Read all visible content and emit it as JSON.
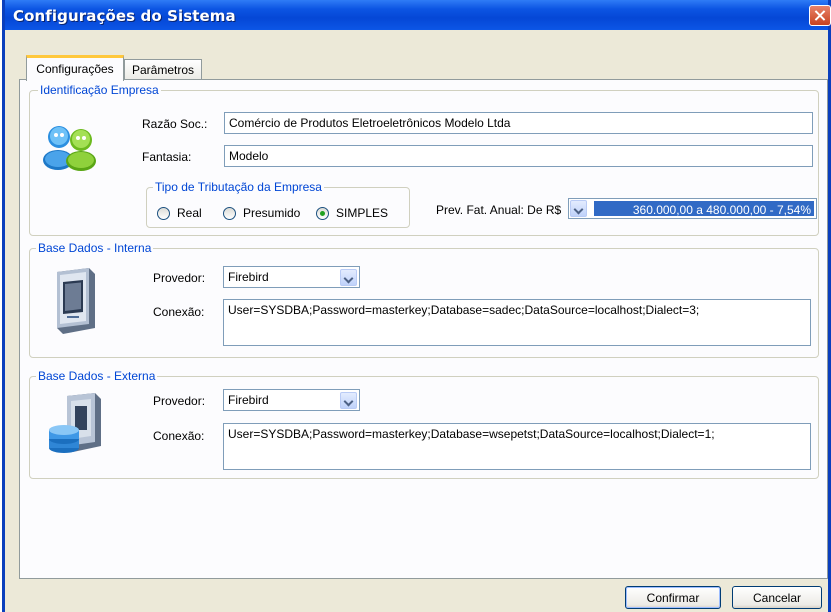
{
  "window": {
    "title": "Configurações do Sistema"
  },
  "tabs": [
    {
      "label": "Configurações",
      "active": true
    },
    {
      "label": "Parâmetros",
      "active": false
    }
  ],
  "empresa": {
    "group_title": "Identificação Empresa",
    "razao_label": "Razão Soc.:",
    "razao_value": "Comércio de Produtos Eletroeletrônicos Modelo Ltda",
    "fantasia_label": "Fantasia:",
    "fantasia_value": "Modelo",
    "icon": "users-icon",
    "tributacao": {
      "group_title": "Tipo de Tributação da Empresa",
      "options": [
        {
          "label": "Real",
          "checked": false
        },
        {
          "label": "Presumido",
          "checked": false
        },
        {
          "label": "SIMPLES",
          "checked": true
        }
      ]
    },
    "prev_fat_label": "Prev. Fat. Anual: De R$",
    "prev_fat_value": "360.000,00 a 480.000,00 - 7,54%"
  },
  "interna": {
    "group_title": "Base Dados - Interna",
    "icon": "server-icon",
    "provedor_label": "Provedor:",
    "provedor_value": "Firebird",
    "conexao_label": "Conexão:",
    "conexao_value": "User=SYSDBA;Password=masterkey;Database=sadec;DataSource=localhost;Dialect=3;"
  },
  "externa": {
    "group_title": "Base Dados - Externa",
    "icon": "database-server-icon",
    "provedor_label": "Provedor:",
    "provedor_value": "Firebird",
    "conexao_label": "Conexão:",
    "conexao_value": "User=SYSDBA;Password=masterkey;Database=wsepetst;DataSource=localhost;Dialect=1;"
  },
  "buttons": {
    "confirm": "Confirmar",
    "cancel": "Cancelar"
  },
  "colors": {
    "accent": "#0046d5",
    "title_bar": "#0054e3",
    "selection": "#316ac5"
  }
}
